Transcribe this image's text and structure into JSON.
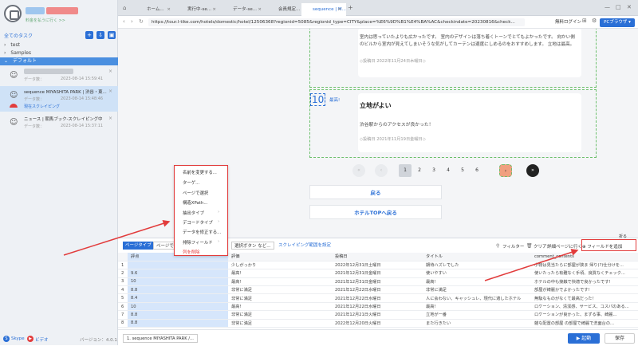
{
  "sidebar": {
    "subtitle": "料金を払うに行く >>",
    "tasks_header": "全てのタスク",
    "folders": [
      "test",
      "Samples",
      "デフォルト"
    ],
    "tasks": [
      {
        "meta": "データ数：",
        "date": "2023-08-14 15:59:41"
      },
      {
        "title": "sequence MIYASHITA PARK | 渋谷・東...",
        "meta": "データ数：",
        "date": "2023-08-14 15:48:46",
        "status": "現在スクレイピング"
      },
      {
        "title": "ニュース | 朝馬ブック-スクレイピング中",
        "meta": "データ数：",
        "date": "2023-08-14 15:37:11"
      }
    ],
    "foot": {
      "skype": "Skype",
      "video": "ビデオ",
      "version": "バージョン：4.0.1"
    }
  },
  "tabs": [
    "ホーム...",
    "実行中-se...",
    "データ-se...",
    "会員規定...",
    "sequence | M..."
  ],
  "address": {
    "url": "https://tour.l-tike.com/hotels/domestic/hotel/12506368?regionid=5085&regionid_type=CITY&place=%E6%9D%B1%E4%BA%AC&checkindate=20230816&check...",
    "login": "無料ログイン",
    "browser": "PCブラウザ"
  },
  "reviews": [
    {
      "body": "室内は思っていたよりも広かったです。 室内のデザインは落ち着くトーンでとてもよかったです。 向かい側のビルから室内が見えてしまいそうな気がしてカーテンは適度にしめるのをおすすめします。 立地は最高。",
      "posted": "◇投稿日 2022年11月24日木曜日◇"
    },
    {
      "score": "10",
      "rank": "最高!",
      "title": "立地がよい",
      "body": "渋谷駅からのアクセスが良かった！",
      "posted": "◇投稿日 2021年11月19日金曜日◇"
    }
  ],
  "pagination": {
    "prev2": "«",
    "prev": "‹",
    "pages": [
      "1",
      "2",
      "3",
      "4",
      "5",
      "6"
    ],
    "next": "›",
    "next2": "»"
  },
  "buttons": {
    "back": "戻る",
    "hotel_top": "ホテルTOPへ戻る"
  },
  "context_menu": [
    "名前を変更する...",
    "ターゲ...",
    "ページで選択",
    "構造XPath...",
    "抽出タイプ",
    "デコードタイプ",
    "データを修正する...",
    "排除フィールド",
    "列を削除"
  ],
  "panel": {
    "tab_page": "ページタイプ",
    "tab_select": "ページで選",
    "select_btn": "選択ボタン など...",
    "link_scrape": "スクレイピング範囲を設定",
    "filter": "フィルター",
    "clear": "クリア",
    "link_next": "詳細ページに行く",
    "add_field": "フィールドを追加",
    "collapse": "折る",
    "columns": [
      "",
      "評点",
      "評価",
      "投稿日",
      "タイトル",
      "comment_contents"
    ],
    "rows": [
      [
        "1",
        "",
        "少しがっかり",
        "2022年12月31日土曜日",
        "期待ハズレでした",
        "小物は見当たらに部屋が狭ま 帰り(?)仕分けを..."
      ],
      [
        "2",
        "9.6",
        "最高!",
        "2021年12月31日金曜日",
        "使いやすい",
        "使いたったら有難なく手頃、良質なくチェック..."
      ],
      [
        "3",
        "10",
        "最高!",
        "2021年12月31日金曜日",
        "最高!",
        "ホテルの中も接触で快適で良かったです!"
      ],
      [
        "4",
        "8.8",
        "非常に満足",
        "2021年12月22日水曜日",
        "非常に満足",
        "部屋が綺麗かでよかったです!"
      ],
      [
        "5",
        "8.4",
        "非常に満足",
        "2021年12月22日水曜日",
        "人に会わない、キャッシュレ、現代に適したホテル",
        "無駄なものがなくて最高だった！"
      ],
      [
        "6",
        "10",
        "最高!",
        "2021年12月22日水曜日",
        "最高!",
        "ロケーション、清潔感、サービス、コスパのある..."
      ],
      [
        "7",
        "8.8",
        "非常に満足",
        "2021年12月21日火曜日",
        "立地が一番",
        "ロケーションが良かった、まずる事、綺麗..."
      ],
      [
        "8",
        "8.8",
        "非常に満足",
        "2022年12月20日火曜日",
        "また行きたい",
        "雑な配置の部屋 の部屋で綺麗で洗面台の..."
      ]
    ],
    "foot_tab": "1. sequence MIYASHITA PARK /...",
    "start": "起動",
    "save": "保存"
  }
}
